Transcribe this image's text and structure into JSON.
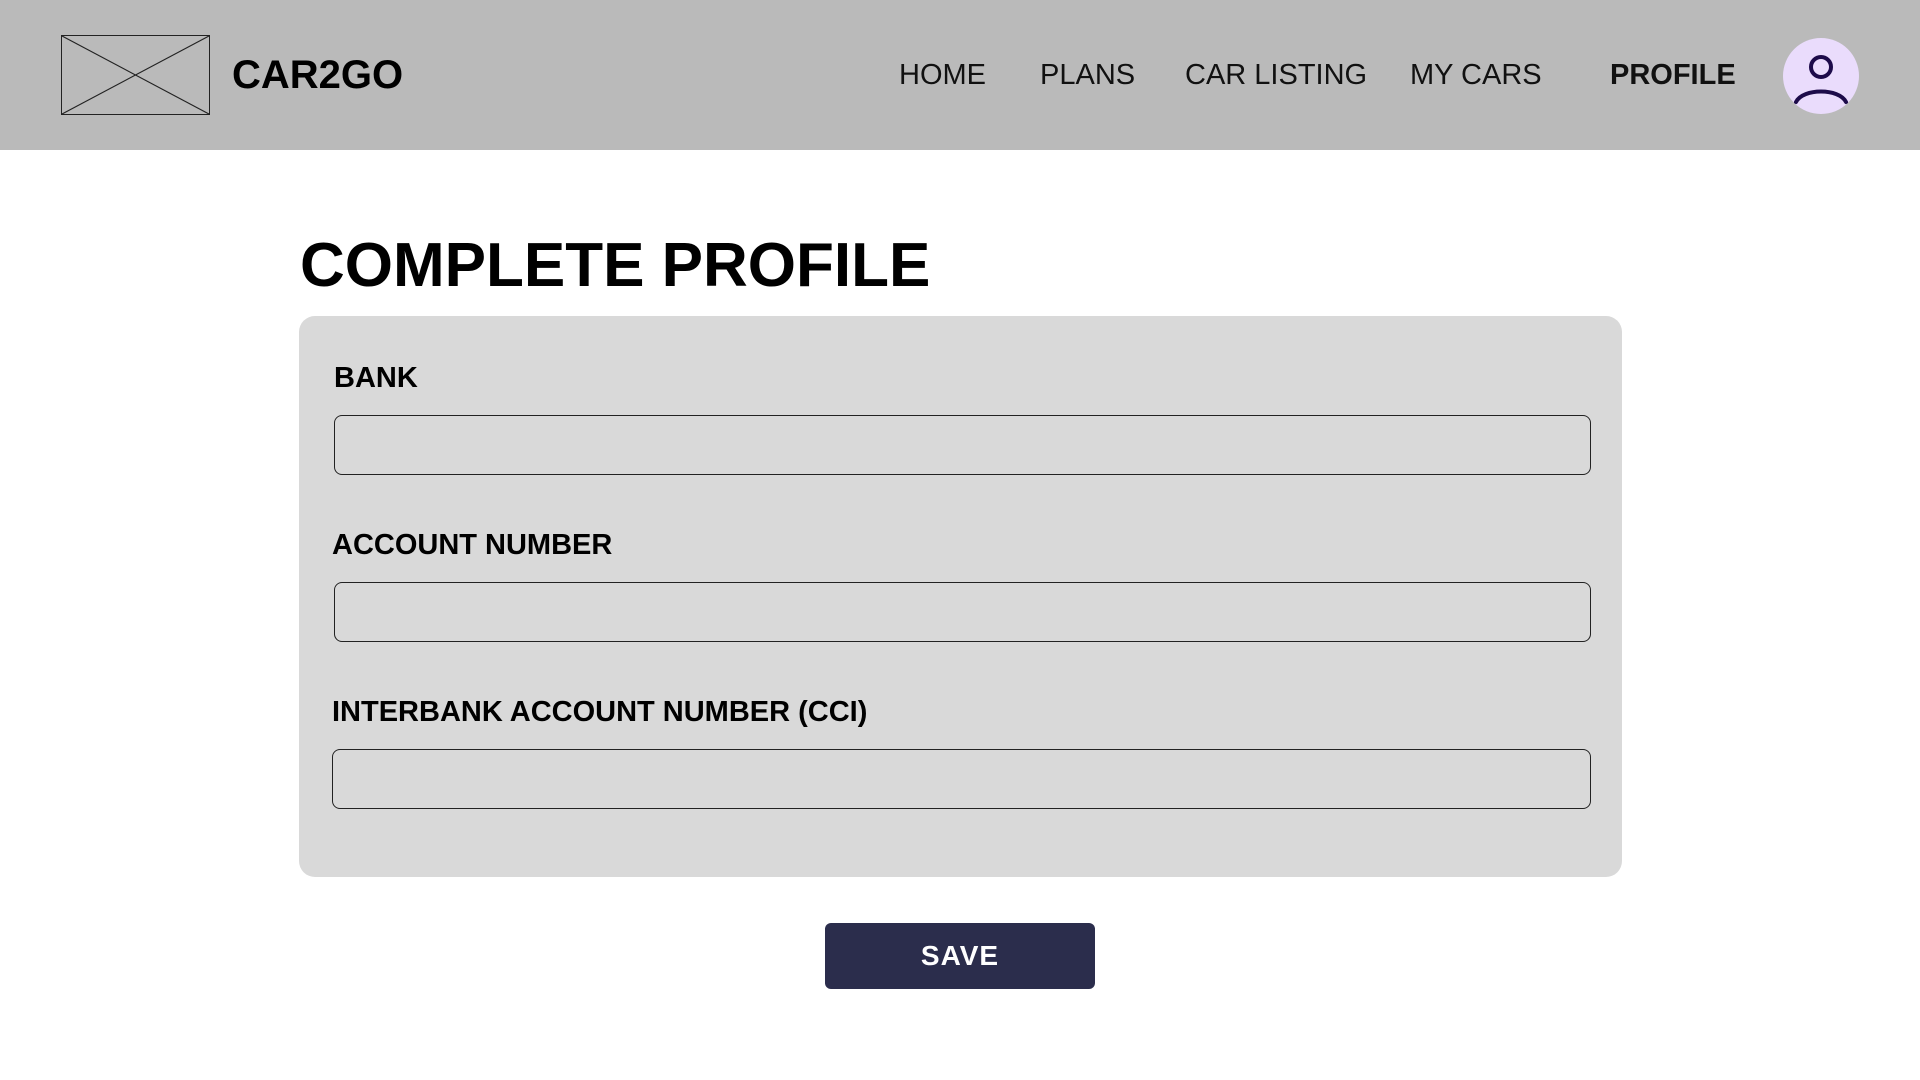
{
  "header": {
    "brand": "CAR2GO",
    "logo_icon": "image-placeholder-icon",
    "nav": [
      {
        "label": "HOME",
        "active": false
      },
      {
        "label": "PLANS",
        "active": false
      },
      {
        "label": "CAR LISTING",
        "active": false
      },
      {
        "label": "MY CARS",
        "active": false
      },
      {
        "label": "PROFILE",
        "active": true
      }
    ],
    "avatar_icon": "user-icon",
    "colors": {
      "bar": "#bababa",
      "avatar_bg": "#eadcfc",
      "avatar_fg": "#1d0b4a"
    }
  },
  "main": {
    "title": "COMPLETE PROFILE",
    "fields": [
      {
        "label": "BANK",
        "value": "",
        "placeholder": ""
      },
      {
        "label": "ACCOUNT NUMBER",
        "value": "",
        "placeholder": ""
      },
      {
        "label": "INTERBANK ACCOUNT NUMBER (CCI)",
        "value": "",
        "placeholder": ""
      }
    ],
    "save_label": "SAVE",
    "colors": {
      "card": "#d9d9d9",
      "save_button": "#2b2d4c"
    }
  }
}
